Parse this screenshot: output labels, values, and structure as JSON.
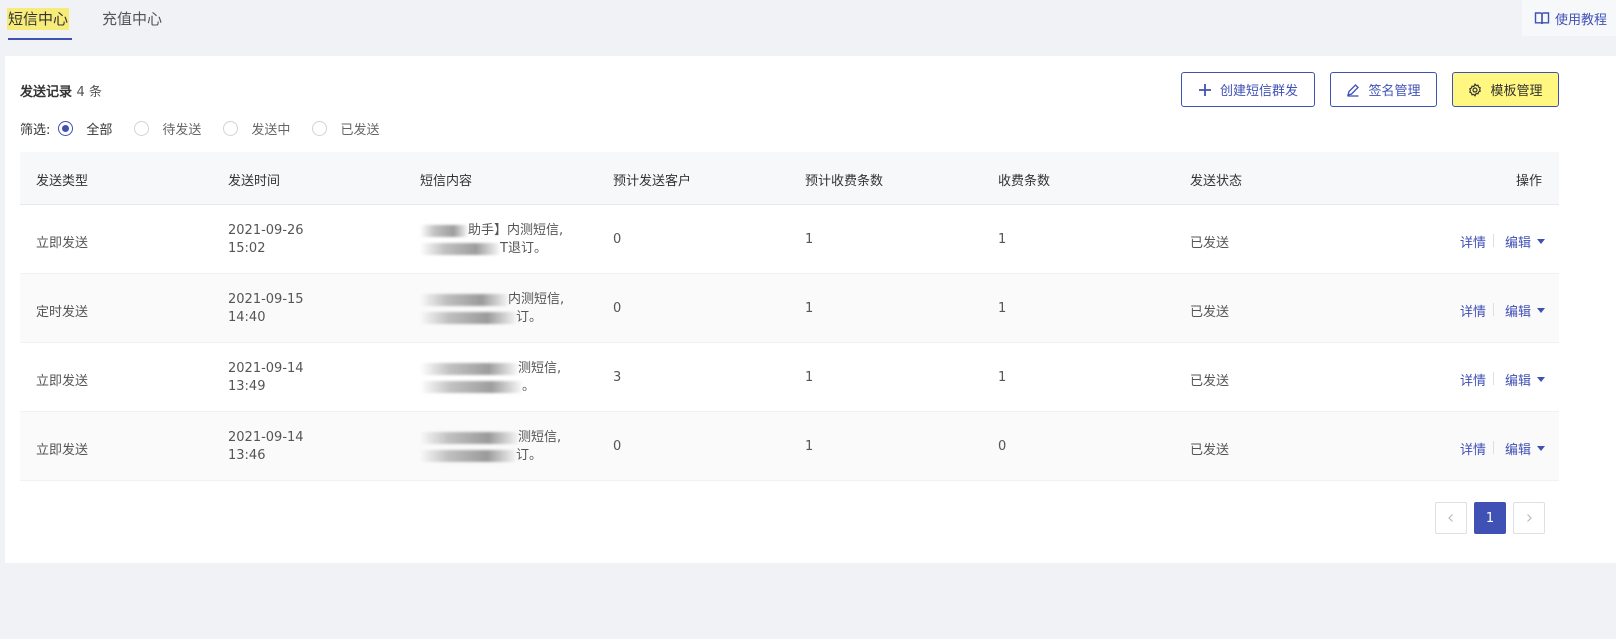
{
  "tabs": [
    {
      "label": "短信中心",
      "active": true
    },
    {
      "label": "充值中心",
      "active": false
    }
  ],
  "help": {
    "label": "使用教程",
    "icon": "book-icon"
  },
  "records": {
    "title": "发送记录",
    "count_text": "4 条"
  },
  "buttons": {
    "create": {
      "label": "创建短信群发",
      "icon": "plus-icon"
    },
    "signature": {
      "label": "签名管理",
      "icon": "pen-icon"
    },
    "template": {
      "label": "模板管理",
      "icon": "gear-icon"
    }
  },
  "filter": {
    "label": "筛选:",
    "options": [
      {
        "label": "全部",
        "checked": true
      },
      {
        "label": "待发送",
        "checked": false
      },
      {
        "label": "发送中",
        "checked": false
      },
      {
        "label": "已发送",
        "checked": false
      }
    ]
  },
  "table": {
    "headers": [
      "发送类型",
      "发送时间",
      "短信内容",
      "预计发送客户",
      "预计收费条数",
      "收费条数",
      "发送状态",
      "操作"
    ],
    "rows": [
      {
        "type": "立即发送",
        "date": "2021-09-26",
        "time": "15:02",
        "content_1": "助手】内测短信,",
        "content_2": "T退订。",
        "customers": "0",
        "est_fee": "1",
        "fee": "1",
        "status": "已发送"
      },
      {
        "type": "定时发送",
        "date": "2021-09-15",
        "time": "14:40",
        "content_1": "内测短信,",
        "content_2": "订。",
        "customers": "0",
        "est_fee": "1",
        "fee": "1",
        "status": "已发送"
      },
      {
        "type": "立即发送",
        "date": "2021-09-14",
        "time": "13:49",
        "content_1": "测短信,",
        "content_2": "。",
        "customers": "3",
        "est_fee": "1",
        "fee": "1",
        "status": "已发送"
      },
      {
        "type": "立即发送",
        "date": "2021-09-14",
        "time": "13:46",
        "content_1": "测短信,",
        "content_2": "订。",
        "customers": "0",
        "est_fee": "1",
        "fee": "0",
        "status": "已发送"
      }
    ],
    "actions": {
      "detail": "详情",
      "edit": "编辑"
    }
  },
  "pagination": {
    "current": "1"
  },
  "colors": {
    "primary": "#3f51b5",
    "highlight": "#fff780",
    "tab_highlight": "#f7ec79"
  }
}
